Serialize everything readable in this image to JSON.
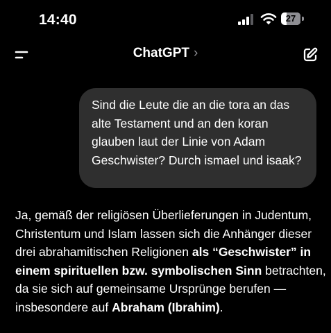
{
  "status_bar": {
    "time": "14:40",
    "battery_level": "27",
    "battery_fraction": 0.27
  },
  "nav": {
    "title": "ChatGPT",
    "title_chevron": "›",
    "menu_icon": "menu-icon",
    "new_chat_icon": "new-chat-icon"
  },
  "conversation": {
    "user_message": "Sind die Leute die an die tora an das alte Testament und an den koran glauben laut der Linie von Adam Geschwister? Durch ismael und isaak?",
    "assistant_message": {
      "seg1": "Ja, gemäß der religiösen Überlieferungen in Judentum, Christentum und Islam lassen sich die Anhänger dieser drei abrahamitischen Religionen ",
      "bold1": "als “Geschwister” in einem spirituellen bzw. symbolischen Sinn",
      "seg2": " betrachten, da sie sich auf gemeinsame Ursprünge berufen — insbesondere auf ",
      "bold2": "Abraham (Ibrahim)",
      "seg3": "."
    }
  },
  "colors": {
    "background": "#000000",
    "user_bubble": "#2f2f2f",
    "text": "#ffffff",
    "muted": "#8e8e93"
  }
}
